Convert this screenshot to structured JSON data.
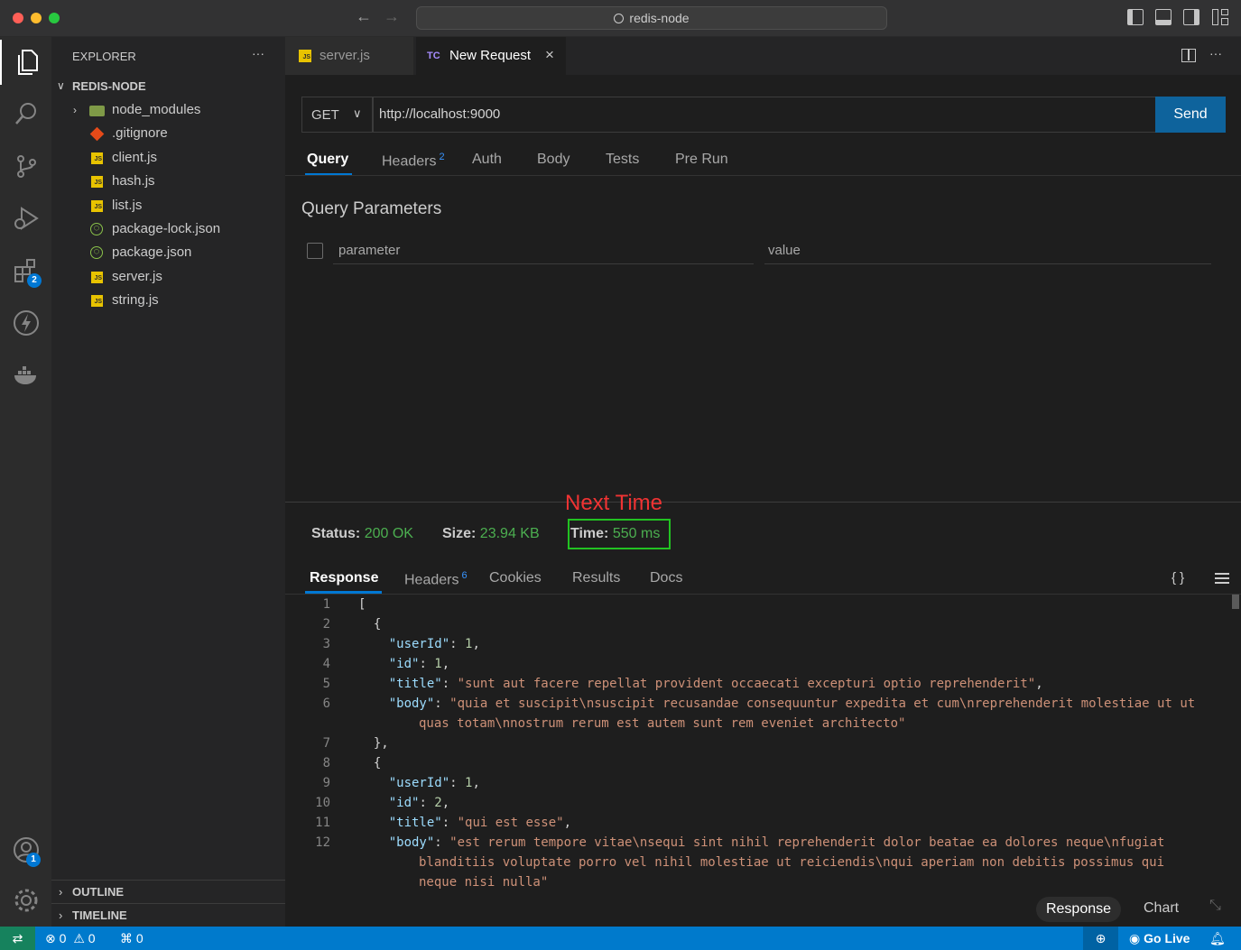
{
  "window": {
    "title": "redis-node"
  },
  "sidebar": {
    "header": "EXPLORER",
    "more": "···",
    "root": "REDIS-NODE",
    "items": [
      {
        "label": "node_modules",
        "kind": "folder"
      },
      {
        "label": ".gitignore",
        "kind": "git"
      },
      {
        "label": "client.js",
        "kind": "js"
      },
      {
        "label": "hash.js",
        "kind": "js"
      },
      {
        "label": "list.js",
        "kind": "js"
      },
      {
        "label": "package-lock.json",
        "kind": "json"
      },
      {
        "label": "package.json",
        "kind": "json"
      },
      {
        "label": "server.js",
        "kind": "js"
      },
      {
        "label": "string.js",
        "kind": "js"
      }
    ],
    "outline": "OUTLINE",
    "timeline": "TIMELINE"
  },
  "activity": {
    "extensions_badge": "2",
    "accounts_badge": "1"
  },
  "tabs": [
    {
      "label": "server.js",
      "icon": "JS"
    },
    {
      "label": "New Request",
      "icon": "TC"
    }
  ],
  "request": {
    "method": "GET",
    "url": "http://localhost:9000",
    "send": "Send",
    "tabs": [
      "Query",
      "Headers",
      "Auth",
      "Body",
      "Tests",
      "Pre Run"
    ],
    "headers_count": "2",
    "section_title": "Query Parameters",
    "param_placeholder": "parameter",
    "value_placeholder": "value"
  },
  "annotation": "Next Time",
  "response": {
    "status_label": "Status:",
    "status_value": "200 OK",
    "size_label": "Size:",
    "size_value": "23.94 KB",
    "time_label": "Time:",
    "time_value": "550 ms",
    "tabs": [
      "Response",
      "Headers",
      "Cookies",
      "Results",
      "Docs"
    ],
    "headers_count": "6",
    "braces": "{ }",
    "bottom_tabs": [
      "Response",
      "Chart"
    ]
  },
  "code_lines": [
    {
      "n": "1",
      "text": "["
    },
    {
      "n": "2",
      "text": "  {"
    },
    {
      "n": "3",
      "key": "\"userId\"",
      "num": "1"
    },
    {
      "n": "4",
      "key": "\"id\"",
      "num": "1"
    },
    {
      "n": "5",
      "key": "\"title\"",
      "str": "\"sunt aut facere repellat provident occaecati excepturi optio reprehenderit\""
    },
    {
      "n": "6",
      "key": "\"body\"",
      "str": "\"quia et suscipit\\nsuscipit recusandae consequuntur expedita et cum\\nreprehenderit molestiae ut ut",
      "cont": "quas totam\\nnostrum rerum est autem sunt rem eveniet architecto\""
    },
    {
      "n": "7",
      "text": "  },"
    },
    {
      "n": "8",
      "text": "  {"
    },
    {
      "n": "9",
      "key": "\"userId\"",
      "num": "1"
    },
    {
      "n": "10",
      "key": "\"id\"",
      "num": "2"
    },
    {
      "n": "11",
      "key": "\"title\"",
      "str": "\"qui est esse\""
    },
    {
      "n": "12",
      "key": "\"body\"",
      "str": "\"est rerum tempore vitae\\nsequi sint nihil reprehenderit dolor beatae ea dolores neque\\nfugiat",
      "cont": "blanditiis voluptate porro vel nihil molestiae ut reiciendis\\nqui aperiam non debitis possimus qui",
      "cont2": "neque nisi nulla\""
    }
  ],
  "statusbar": {
    "errors": "0",
    "warnings": "0",
    "ports": "0",
    "go_live": "Go Live"
  }
}
